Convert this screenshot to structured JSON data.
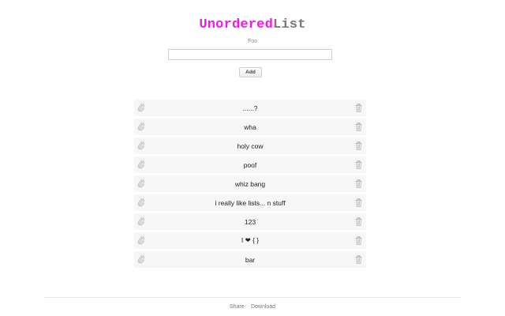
{
  "title": {
    "part1": "Unordered",
    "part2": "List",
    "part1_color": "#e91ee0",
    "part2_color": "#777777"
  },
  "form": {
    "label": "Foo",
    "input_value": "",
    "input_placeholder": "",
    "add_label": "Add"
  },
  "items": [
    {
      "text": "......?",
      "clip_icon": "paperclip-icon",
      "delete_icon": "trash-icon"
    },
    {
      "text": "wha",
      "clip_icon": "paperclip-icon",
      "delete_icon": "trash-icon"
    },
    {
      "text": "holy cow",
      "clip_icon": "paperclip-icon",
      "delete_icon": "trash-icon"
    },
    {
      "text": "poof",
      "clip_icon": "paperclip-icon",
      "delete_icon": "trash-icon"
    },
    {
      "text": "whiz bang",
      "clip_icon": "paperclip-icon",
      "delete_icon": "trash-icon"
    },
    {
      "text": "i really like lists... n stuff",
      "clip_icon": "paperclip-icon",
      "delete_icon": "trash-icon"
    },
    {
      "text": "123",
      "clip_icon": "paperclip-icon",
      "delete_icon": "trash-icon"
    },
    {
      "text": "I ❤ { }",
      "clip_icon": "paperclip-icon",
      "delete_icon": "trash-icon"
    },
    {
      "text": "bar",
      "clip_icon": "paperclip-icon",
      "delete_icon": "trash-icon"
    }
  ],
  "footer": {
    "share_label": "Share",
    "separator": "·",
    "download_label": "Download"
  }
}
